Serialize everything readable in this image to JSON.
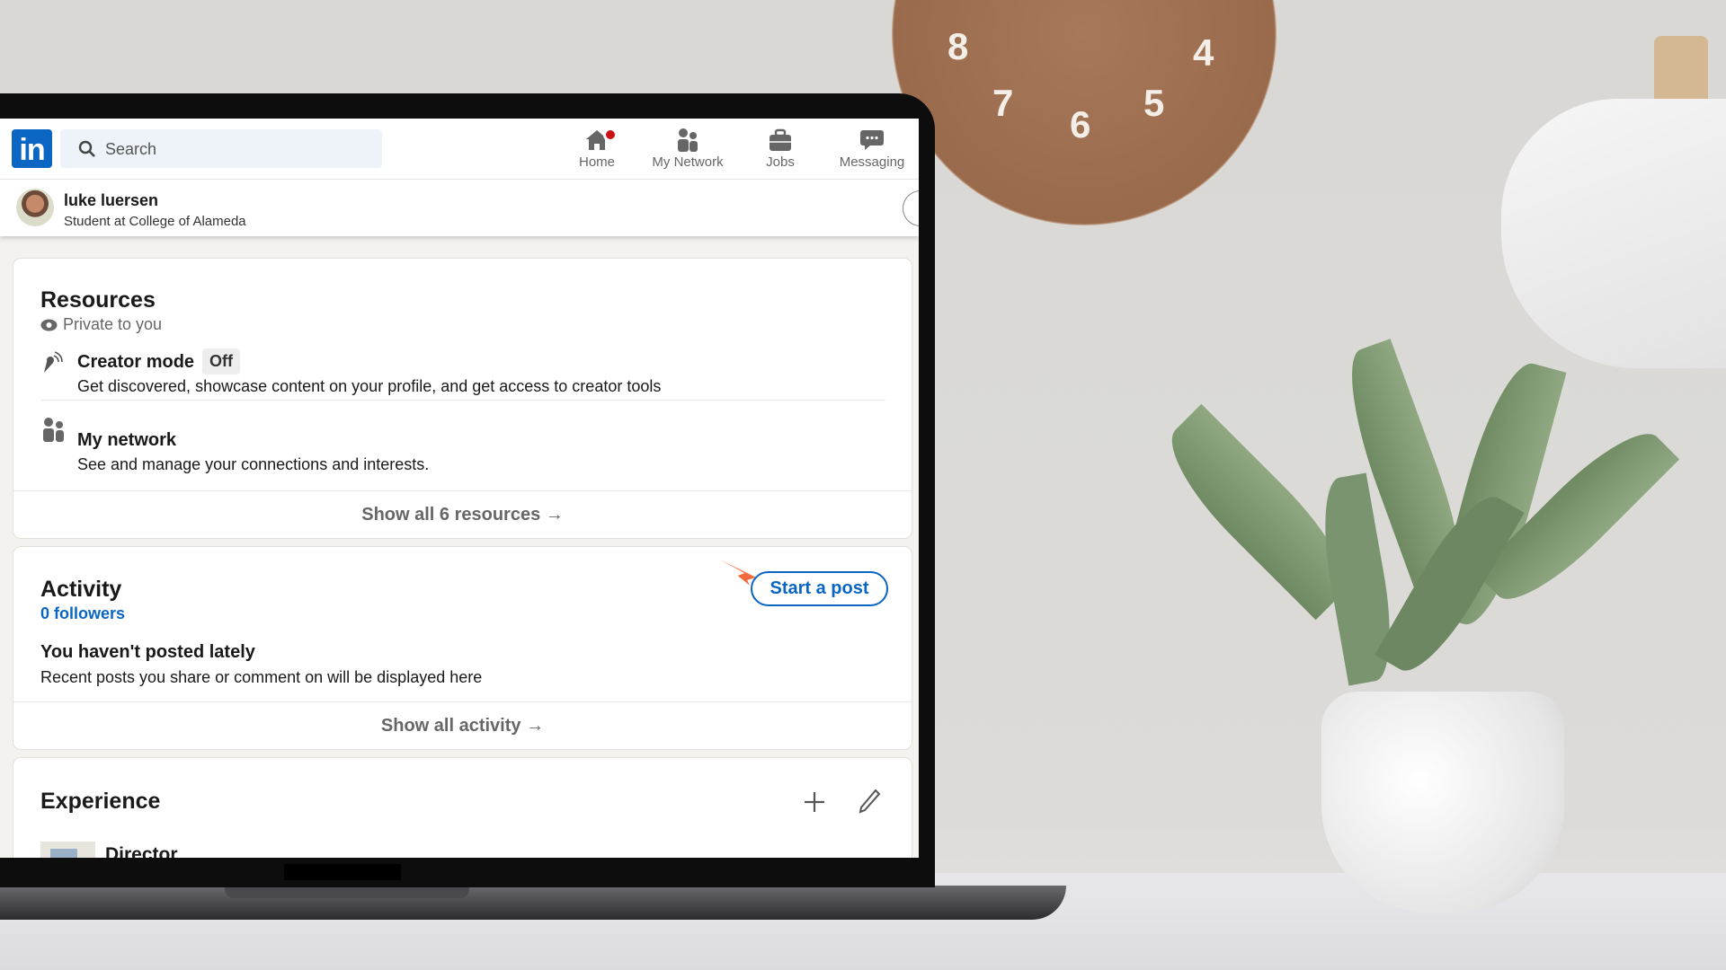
{
  "nav": {
    "search_placeholder": "Search",
    "logo": "in",
    "items": [
      {
        "label": "Home",
        "icon": "home-icon",
        "has_badge": true
      },
      {
        "label": "My Network",
        "icon": "network-icon"
      },
      {
        "label": "Jobs",
        "icon": "briefcase-icon"
      },
      {
        "label": "Messaging",
        "icon": "messaging-icon"
      }
    ]
  },
  "profile": {
    "name": "luke luersen",
    "headline": "Student at College of Alameda"
  },
  "resources": {
    "title": "Resources",
    "privacy": "Private to you",
    "items": [
      {
        "title": "Creator mode",
        "badge": "Off",
        "description": "Get discovered, showcase content on your profile, and get access to creator tools"
      },
      {
        "title": "My network",
        "description": "See and manage your connections and interests."
      }
    ],
    "footer": "Show all 6 resources →"
  },
  "activity": {
    "title": "Activity",
    "followers": "0 followers",
    "start_post": "Start a post",
    "empty_title": "You haven't posted lately",
    "empty_desc": "Recent posts you share or comment on will be displayed here",
    "footer": "Show all activity →"
  },
  "experience": {
    "title": "Experience",
    "first_item": "Director"
  },
  "clock": {
    "numbers": [
      "8",
      "7",
      "6",
      "5",
      "4"
    ]
  },
  "colors": {
    "brand": "#0a66c2",
    "badge": "#cc1016",
    "arrow": "#f26a3d"
  }
}
